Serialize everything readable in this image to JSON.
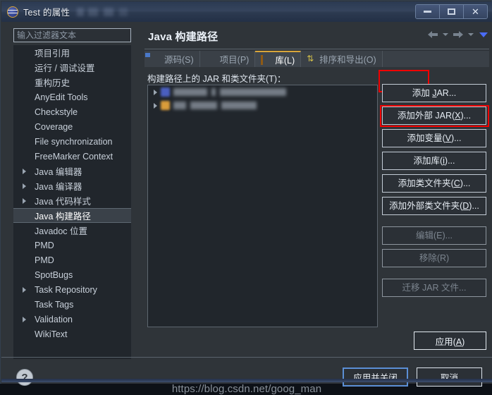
{
  "window": {
    "title": "Test 的属性",
    "app_icon": "eclipse-icon",
    "controls": [
      {
        "name": "minimize-button",
        "glyph": "minimize"
      },
      {
        "name": "maximize-button",
        "glyph": "maximize"
      },
      {
        "name": "close-button",
        "glyph": "close"
      }
    ]
  },
  "sidebar": {
    "filter": {
      "value": "",
      "placeholder": "输入过滤器文本"
    },
    "items": [
      {
        "label": "项目引用",
        "expandable": false,
        "selected": false
      },
      {
        "label": "运行 / 调试设置",
        "expandable": false,
        "selected": false
      },
      {
        "label": "重构历史",
        "expandable": false,
        "selected": false
      },
      {
        "label": "AnyEdit Tools",
        "expandable": false,
        "selected": false
      },
      {
        "label": "Checkstyle",
        "expandable": false,
        "selected": false
      },
      {
        "label": "Coverage",
        "expandable": false,
        "selected": false
      },
      {
        "label": "File synchronization",
        "expandable": false,
        "selected": false
      },
      {
        "label": "FreeMarker Context",
        "expandable": false,
        "selected": false
      },
      {
        "label": "Java 编辑器",
        "expandable": true,
        "selected": false
      },
      {
        "label": "Java 编译器",
        "expandable": true,
        "selected": false
      },
      {
        "label": "Java 代码样式",
        "expandable": true,
        "selected": false
      },
      {
        "label": "Java 构建路径",
        "expandable": false,
        "selected": true
      },
      {
        "label": "Javadoc 位置",
        "expandable": false,
        "selected": false
      },
      {
        "label": "PMD",
        "expandable": false,
        "selected": false
      },
      {
        "label": "PMD",
        "expandable": false,
        "selected": false
      },
      {
        "label": "SpotBugs",
        "expandable": false,
        "selected": false
      },
      {
        "label": "Task Repository",
        "expandable": true,
        "selected": false
      },
      {
        "label": "Task Tags",
        "expandable": false,
        "selected": false
      },
      {
        "label": "Validation",
        "expandable": true,
        "selected": false
      },
      {
        "label": "WikiText",
        "expandable": false,
        "selected": false
      }
    ]
  },
  "page": {
    "title": "Java 构建路径",
    "nav": {
      "back_icon": "arrow-left-icon",
      "back_menu_icon": "chevron-down-icon",
      "forward_icon": "arrow-right-icon",
      "forward_menu_icon": "chevron-down-icon",
      "view_menu_icon": "chevron-down-blue-icon"
    },
    "tabs": [
      {
        "label": "源码(S)",
        "icon": "folder-source-icon",
        "active": false
      },
      {
        "label": "项目(P)",
        "icon": "folder-project-icon",
        "active": false
      },
      {
        "label": "库(L)",
        "icon": "library-book-icon",
        "active": true
      },
      {
        "label": "排序和导出(O)",
        "icon": "sort-order-icon",
        "active": false
      }
    ],
    "section_label": "构建路径上的 JAR 和类文件夹(T)：",
    "jar_entries": [
      {
        "icon": "jar-icon",
        "label_redacted": true,
        "expandable": true
      },
      {
        "icon": "jre-library-icon",
        "label_redacted": true,
        "expandable": true
      }
    ],
    "side_buttons": [
      {
        "label": "添加 JAR...",
        "mnemonic": "J",
        "disabled": false,
        "highlighted": false,
        "name": "add-jar-button"
      },
      {
        "label": "添加外部 JAR(X)...",
        "mnemonic": "X",
        "disabled": false,
        "highlighted": true,
        "name": "add-external-jar-button"
      },
      {
        "label": "添加变量(V)...",
        "mnemonic": "V",
        "disabled": false,
        "highlighted": false,
        "name": "add-variable-button"
      },
      {
        "label": "添加库(i)...",
        "mnemonic": "i",
        "disabled": false,
        "highlighted": false,
        "name": "add-library-button"
      },
      {
        "label": "添加类文件夹(C)...",
        "mnemonic": "C",
        "disabled": false,
        "highlighted": false,
        "name": "add-class-folder-button"
      },
      {
        "label": "添加外部类文件夹(D)...",
        "mnemonic": "D",
        "disabled": false,
        "highlighted": false,
        "name": "add-external-class-folder-button"
      },
      {
        "label": "编辑(E)...",
        "mnemonic": "E",
        "disabled": true,
        "highlighted": false,
        "name": "edit-button"
      },
      {
        "label": "移除(R)",
        "mnemonic": "R",
        "disabled": true,
        "highlighted": false,
        "name": "remove-button"
      },
      {
        "label": "迁移 JAR 文件...",
        "mnemonic": "",
        "disabled": true,
        "highlighted": false,
        "name": "migrate-jar-button"
      }
    ],
    "apply_label": "应用(A)",
    "apply_mnemonic": "A"
  },
  "footer": {
    "help_icon": "help-question-icon",
    "apply_and_close_label": "应用并关闭",
    "cancel_label": "取消"
  },
  "watermark": "https://blog.csdn.net/goog_man",
  "colors": {
    "dialog_bg": "#2f3439",
    "list_bg": "#21262c",
    "accent_red": "#f00000",
    "tab_accent": "#d8a53a",
    "default_button_border": "#5b8fd6",
    "titlebar": "#35445d"
  }
}
